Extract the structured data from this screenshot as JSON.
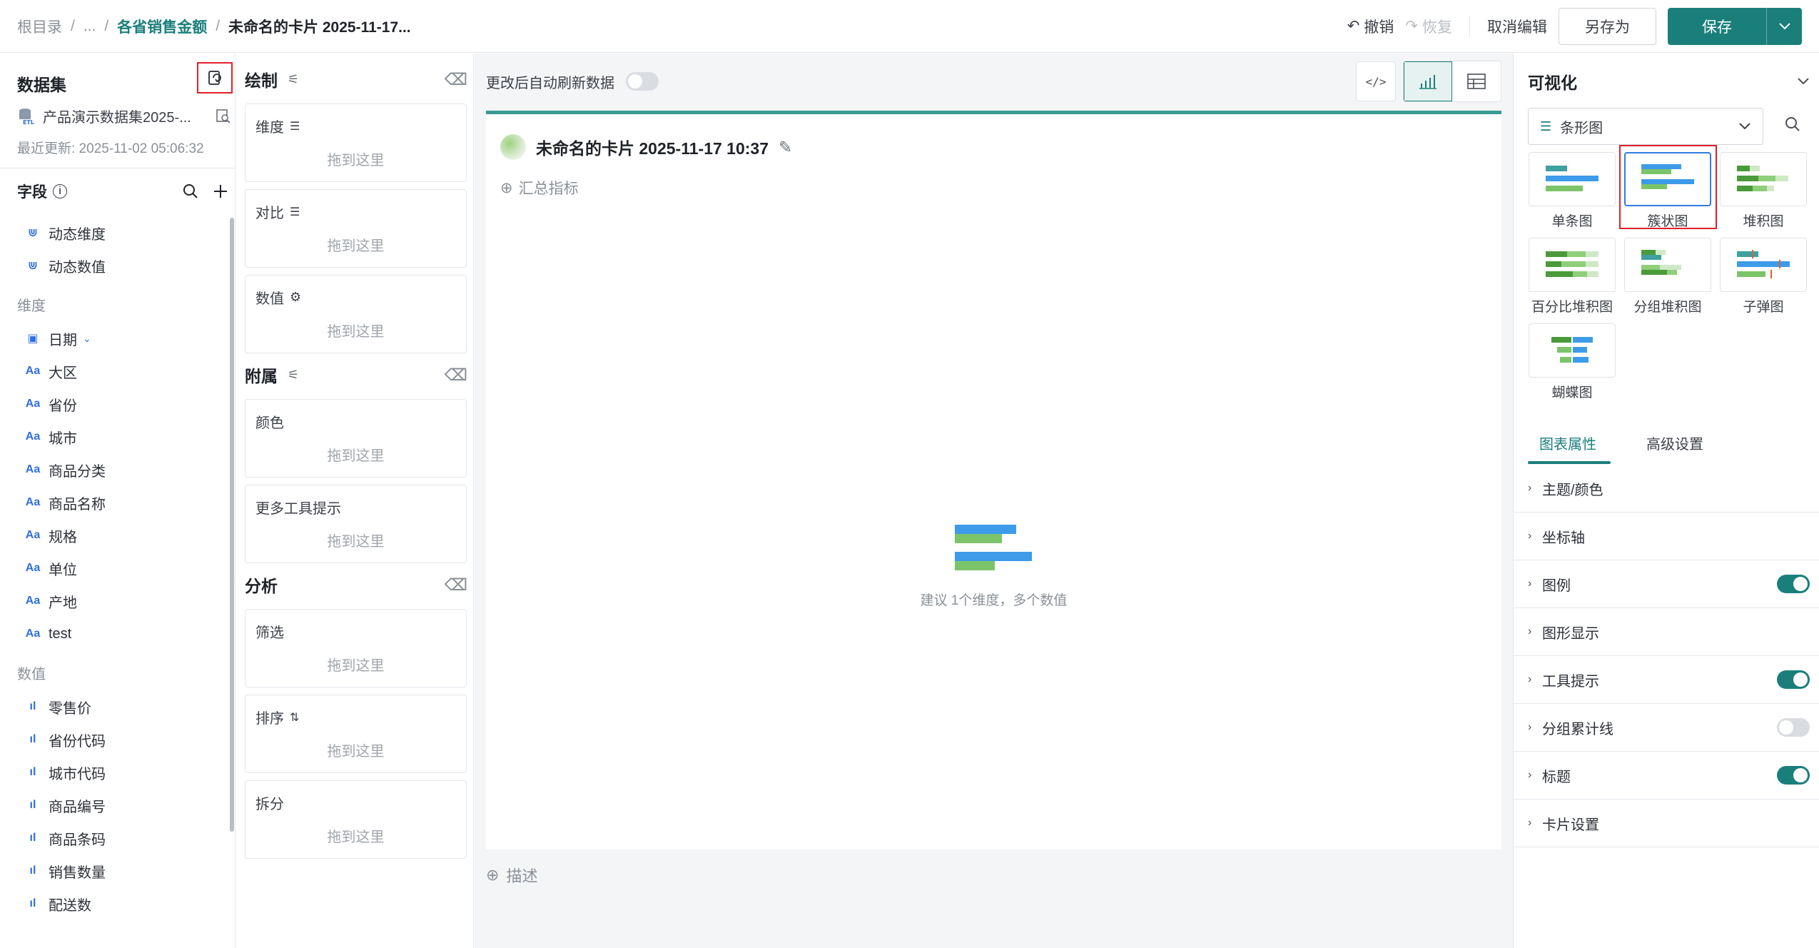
{
  "breadcrumb": [
    "根目录",
    "...",
    "各省销售金额",
    "未命名的卡片 2025-11-17..."
  ],
  "toolbar": {
    "undo": "撤销",
    "redo": "恢复",
    "cancel_edit": "取消编辑",
    "save_as": "另存为",
    "save": "保存"
  },
  "dataset": {
    "title": "数据集",
    "name": "产品演示数据集2025-...",
    "updated": "最近更新: 2025-11-02 05:06:32"
  },
  "fields": {
    "title": "字段",
    "dynamic": [
      "动态维度",
      "动态数值"
    ],
    "dimension_group": "维度",
    "dimensions": [
      "日期",
      "大区",
      "省份",
      "城市",
      "商品分类",
      "商品名称",
      "规格",
      "单位",
      "产地",
      "test"
    ],
    "measure_group": "数值",
    "measures": [
      "零售价",
      "省份代码",
      "城市代码",
      "商品编号",
      "商品条码",
      "销售数量",
      "配送数"
    ]
  },
  "config": {
    "draw_title": "绘制",
    "dimension": "维度",
    "compare": "对比",
    "value": "数值",
    "attach_title": "附属",
    "color": "颜色",
    "tooltip": "更多工具提示",
    "analysis_title": "分析",
    "filter": "筛选",
    "sort": "排序",
    "split": "拆分",
    "drop_hint": "拖到这里"
  },
  "canvas": {
    "auto_refresh": "更改后自动刷新数据",
    "auto_refresh_on": false,
    "card_title": "未命名的卡片 2025-11-17 10:37",
    "summary": "汇总指标",
    "empty_hint": "建议 1个维度，多个数值",
    "description": "描述"
  },
  "visual": {
    "title": "可视化",
    "selected_type": "条形图",
    "types": [
      "单条图",
      "簇状图",
      "堆积图",
      "百分比堆积图",
      "分组堆积图",
      "子弹图",
      "蝴蝶图"
    ],
    "active_type": "簇状图",
    "tabs": [
      "图表属性",
      "高级设置"
    ],
    "props": [
      {
        "label": "主题/颜色",
        "toggle": null
      },
      {
        "label": "坐标轴",
        "toggle": null
      },
      {
        "label": "图例",
        "toggle": true
      },
      {
        "label": "图形显示",
        "toggle": null
      },
      {
        "label": "工具提示",
        "toggle": true
      },
      {
        "label": "分组累计线",
        "toggle": false
      },
      {
        "label": "标题",
        "toggle": true
      },
      {
        "label": "卡片设置",
        "toggle": null
      }
    ]
  },
  "colors": {
    "accent": "#1a7f7a",
    "bar_blue": "#3d9be9",
    "bar_green": "#7cc46a",
    "highlight_red": "#e0202a"
  }
}
